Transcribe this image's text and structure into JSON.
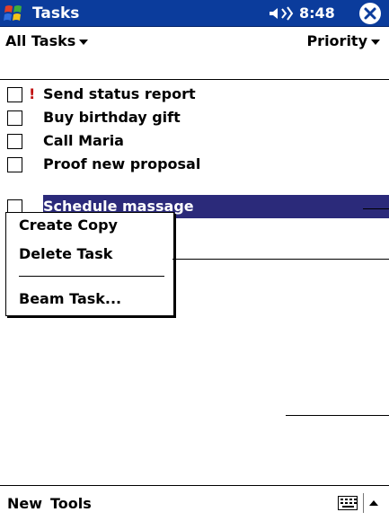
{
  "titlebar": {
    "app_title": "Tasks",
    "time": "8:48"
  },
  "filter": {
    "category": "All Tasks",
    "sort": "Priority"
  },
  "tasks": [
    {
      "priority_mark": "!",
      "name": "Send status report",
      "selected": false
    },
    {
      "priority_mark": "",
      "name": "Buy birthday gift",
      "selected": false
    },
    {
      "priority_mark": "",
      "name": "Call Maria",
      "selected": false
    },
    {
      "priority_mark": "",
      "name": "Proof new proposal",
      "selected": false
    },
    {
      "priority_mark": "↓",
      "name": "Schedule massage",
      "selected": true
    }
  ],
  "context_menu": {
    "items": [
      "Create Copy",
      "Delete Task",
      "Beam Task..."
    ]
  },
  "command_bar": {
    "new_label": "New",
    "tools_label": "Tools"
  },
  "colors": {
    "titlebar": "#0b3c9c",
    "selection": "#2b2a7a",
    "high_priority": "#c01010"
  }
}
